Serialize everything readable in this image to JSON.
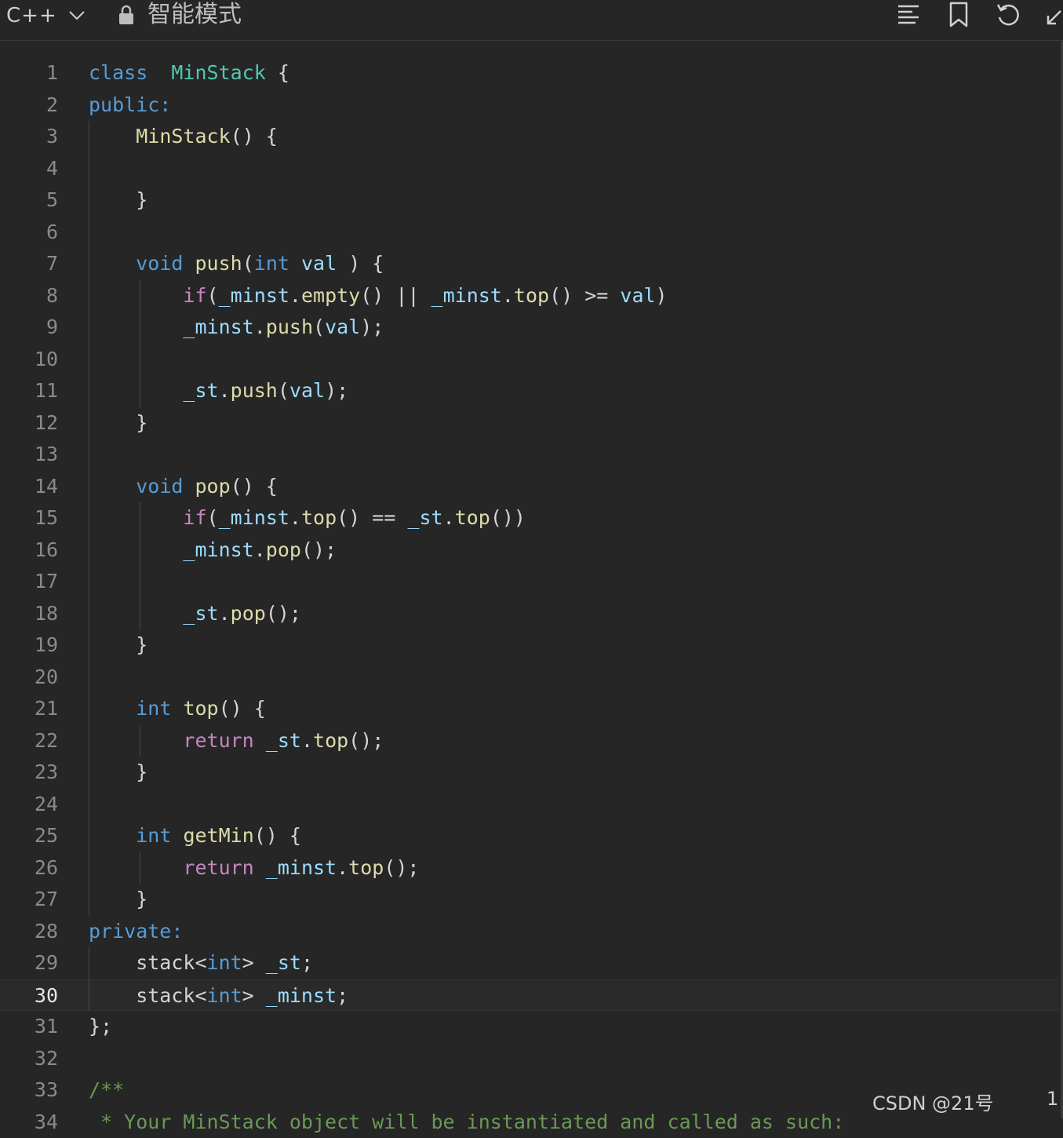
{
  "toolbar": {
    "language": "C++",
    "mode": "智能模式",
    "icons": [
      "chevron-down-icon",
      "lock-icon",
      "format-icon",
      "bookmark-icon",
      "reset-icon",
      "expand-icon"
    ]
  },
  "editor": {
    "current_line": 30,
    "lines": [
      {
        "n": "1",
        "tokens": [
          [
            "kw",
            "class"
          ],
          [
            "",
            "  "
          ],
          [
            "ty",
            "MinStack"
          ],
          [
            "",
            " {"
          ]
        ]
      },
      {
        "n": "2",
        "tokens": [
          [
            "kw",
            "public:"
          ]
        ]
      },
      {
        "n": "3",
        "tokens": [
          [
            "",
            "    "
          ],
          [
            "fn",
            "MinStack"
          ],
          [
            "",
            "() {"
          ]
        ]
      },
      {
        "n": "4",
        "tokens": []
      },
      {
        "n": "5",
        "tokens": [
          [
            "",
            "    }"
          ]
        ]
      },
      {
        "n": "6",
        "tokens": []
      },
      {
        "n": "7",
        "tokens": [
          [
            "",
            "    "
          ],
          [
            "kw",
            "void"
          ],
          [
            "",
            " "
          ],
          [
            "fn",
            "push"
          ],
          [
            "",
            "("
          ],
          [
            "kw",
            "int"
          ],
          [
            "",
            " "
          ],
          [
            "var",
            "val"
          ],
          [
            "",
            " ) {"
          ]
        ]
      },
      {
        "n": "8",
        "tokens": [
          [
            "",
            "        "
          ],
          [
            "ctl",
            "if"
          ],
          [
            "",
            "("
          ],
          [
            "var",
            "_minst"
          ],
          [
            ".",
            "."
          ],
          [
            "fn",
            "empty"
          ],
          [
            "",
            "() || "
          ],
          [
            "var",
            "_minst"
          ],
          [
            ".",
            "."
          ],
          [
            "fn",
            "top"
          ],
          [
            "",
            "() >= "
          ],
          [
            "var",
            "val"
          ],
          [
            "",
            ")"
          ]
        ]
      },
      {
        "n": "9",
        "tokens": [
          [
            "",
            "        "
          ],
          [
            "var",
            "_minst"
          ],
          [
            "",
            "."
          ],
          [
            "fn",
            "push"
          ],
          [
            "",
            "("
          ],
          [
            "var",
            "val"
          ],
          [
            "",
            ");"
          ]
        ]
      },
      {
        "n": "10",
        "tokens": []
      },
      {
        "n": "11",
        "tokens": [
          [
            "",
            "        "
          ],
          [
            "var",
            "_st"
          ],
          [
            "",
            "."
          ],
          [
            "fn",
            "push"
          ],
          [
            "",
            "("
          ],
          [
            "var",
            "val"
          ],
          [
            "",
            ");"
          ]
        ]
      },
      {
        "n": "12",
        "tokens": [
          [
            "",
            "    }"
          ]
        ]
      },
      {
        "n": "13",
        "tokens": []
      },
      {
        "n": "14",
        "tokens": [
          [
            "",
            "    "
          ],
          [
            "kw",
            "void"
          ],
          [
            "",
            " "
          ],
          [
            "fn",
            "pop"
          ],
          [
            "",
            "() {"
          ]
        ]
      },
      {
        "n": "15",
        "tokens": [
          [
            "",
            "        "
          ],
          [
            "ctl",
            "if"
          ],
          [
            "",
            "("
          ],
          [
            "var",
            "_minst"
          ],
          [
            "",
            "."
          ],
          [
            "fn",
            "top"
          ],
          [
            "",
            "() == "
          ],
          [
            "var",
            "_st"
          ],
          [
            "",
            "."
          ],
          [
            "fn",
            "top"
          ],
          [
            "",
            "())"
          ]
        ]
      },
      {
        "n": "16",
        "tokens": [
          [
            "",
            "        "
          ],
          [
            "var",
            "_minst"
          ],
          [
            "",
            "."
          ],
          [
            "fn",
            "pop"
          ],
          [
            "",
            "();"
          ]
        ]
      },
      {
        "n": "17",
        "tokens": []
      },
      {
        "n": "18",
        "tokens": [
          [
            "",
            "        "
          ],
          [
            "var",
            "_st"
          ],
          [
            "",
            "."
          ],
          [
            "fn",
            "pop"
          ],
          [
            "",
            "();"
          ]
        ]
      },
      {
        "n": "19",
        "tokens": [
          [
            "",
            "    }"
          ]
        ]
      },
      {
        "n": "20",
        "tokens": []
      },
      {
        "n": "21",
        "tokens": [
          [
            "",
            "    "
          ],
          [
            "kw",
            "int"
          ],
          [
            "",
            " "
          ],
          [
            "fn",
            "top"
          ],
          [
            "",
            "() {"
          ]
        ]
      },
      {
        "n": "22",
        "tokens": [
          [
            "",
            "        "
          ],
          [
            "ctl",
            "return"
          ],
          [
            "",
            " "
          ],
          [
            "var",
            "_st"
          ],
          [
            "",
            "."
          ],
          [
            "fn",
            "top"
          ],
          [
            "",
            "();"
          ]
        ]
      },
      {
        "n": "23",
        "tokens": [
          [
            "",
            "    }"
          ]
        ]
      },
      {
        "n": "24",
        "tokens": []
      },
      {
        "n": "25",
        "tokens": [
          [
            "",
            "    "
          ],
          [
            "kw",
            "int"
          ],
          [
            "",
            " "
          ],
          [
            "fn",
            "getMin"
          ],
          [
            "",
            "() {"
          ]
        ]
      },
      {
        "n": "26",
        "tokens": [
          [
            "",
            "        "
          ],
          [
            "ctl",
            "return"
          ],
          [
            "",
            " "
          ],
          [
            "var",
            "_minst"
          ],
          [
            "",
            "."
          ],
          [
            "fn",
            "top"
          ],
          [
            "",
            "();"
          ]
        ]
      },
      {
        "n": "27",
        "tokens": [
          [
            "",
            "    }"
          ]
        ]
      },
      {
        "n": "28",
        "tokens": [
          [
            "kw",
            "private:"
          ]
        ]
      },
      {
        "n": "29",
        "tokens": [
          [
            "",
            "    stack<"
          ],
          [
            "kw",
            "int"
          ],
          [
            "",
            "> "
          ],
          [
            "var",
            "_st"
          ],
          [
            "",
            ";"
          ]
        ]
      },
      {
        "n": "30",
        "tokens": [
          [
            "",
            "    stack<"
          ],
          [
            "kw",
            "int"
          ],
          [
            "",
            "> "
          ],
          [
            "var",
            "_minst"
          ],
          [
            "",
            ";"
          ]
        ]
      },
      {
        "n": "31",
        "tokens": [
          [
            "",
            "};"
          ]
        ]
      },
      {
        "n": "32",
        "tokens": []
      },
      {
        "n": "33",
        "tokens": [
          [
            "cm",
            "/**"
          ]
        ]
      },
      {
        "n": "34",
        "tokens": [
          [
            "cm",
            " * Your MinStack object will be instantiated and called as such:"
          ]
        ]
      }
    ]
  },
  "watermark": "CSDN @21号",
  "corner_number": "1"
}
